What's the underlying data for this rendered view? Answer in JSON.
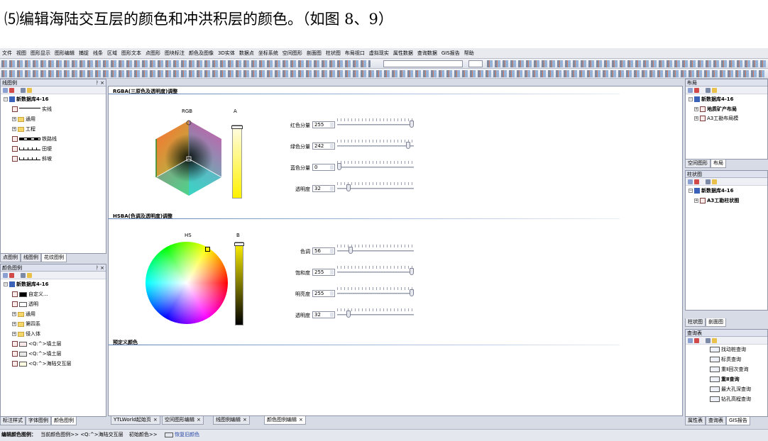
{
  "caption": "⑸编辑海陆交互层的颜色和冲洪积层的颜色。（如图 8、9）",
  "menu": [
    "文件",
    "视图",
    "图形显示",
    "图形编辑",
    "捕捉",
    "线条",
    "区域",
    "图形文本",
    "点图形",
    "图块标注",
    "颜色及图像",
    "3D实体",
    "数据点",
    "坐标系统",
    "空间图形",
    "剖面图",
    "柱状图",
    "布局视口",
    "虚拟现实",
    "属性数据",
    "查询数据",
    "GIS报告",
    "帮助"
  ],
  "left_top_panel": {
    "title": "线图例",
    "tree": {
      "root": "新数据库4-16",
      "items": [
        {
          "label": "实线",
          "type": "line-solid"
        },
        {
          "label": "通用",
          "type": "folder"
        },
        {
          "label": "工程",
          "type": "folder"
        },
        {
          "label": "铁路线",
          "type": "line-rail"
        },
        {
          "label": "田埂",
          "type": "line-ridge"
        },
        {
          "label": "斜坡",
          "type": "line-slope"
        }
      ]
    },
    "tabs": [
      "点图例",
      "线图例",
      "花纹图例"
    ]
  },
  "left_bottom_panel": {
    "title": "颜色图例",
    "tree": {
      "root": "新数据库4-16",
      "items": [
        {
          "label": "自定义...",
          "swatch": "#000000"
        },
        {
          "label": "透明",
          "swatch": "#ffffff"
        },
        {
          "label": "通用",
          "type": "folder"
        },
        {
          "label": "第四系",
          "type": "folder"
        },
        {
          "label": "侵入体",
          "type": "folder"
        },
        {
          "label": "<Q:^>填土层",
          "swatch": "#f8e8ea"
        },
        {
          "label": "<Q:^>填土层",
          "swatch": "#e8e8e8"
        },
        {
          "label": "<Q:^>海陆交互层",
          "swatch": "#fffbe0"
        }
      ]
    },
    "tabs": [
      "标注样式",
      "字体图例",
      "颜色图例"
    ]
  },
  "editor": {
    "rgba_title": "RGBA(三原色及透明度)调整",
    "hsba_title": "HSBA(色调及透明度)调整",
    "preset_title": "预定义颜色",
    "rgb_label": "RGB",
    "a_label": "A",
    "hs_label": "HS",
    "b_label": "B",
    "rgba_sliders": [
      {
        "label": "红色分量",
        "value": "255",
        "max": 255
      },
      {
        "label": "绿色分量",
        "value": "242",
        "max": 255
      },
      {
        "label": "蓝色分量",
        "value": "0",
        "max": 255
      },
      {
        "label": "透明度",
        "value": "32",
        "max": 255
      }
    ],
    "hsba_sliders": [
      {
        "label": "色调",
        "value": "56",
        "max": 360
      },
      {
        "label": "饱和度",
        "value": "255",
        "max": 255
      },
      {
        "label": "明亮度",
        "value": "255",
        "max": 255
      },
      {
        "label": "透明度",
        "value": "32",
        "max": 255
      }
    ],
    "current_color": "#fff200"
  },
  "doc_tabs": [
    "YTLWorld起始页",
    "空间图形编辑",
    "线图例编辑",
    "颜色图例编辑"
  ],
  "right_panels": {
    "layout": {
      "title": "布局",
      "root": "新数据库4-16",
      "items": [
        "地质矿产布局",
        "A3工勘布局模"
      ],
      "tabs": [
        "空间图形",
        "布局"
      ]
    },
    "column": {
      "title": "柱状图",
      "root": "新数据库4-16",
      "items": [
        "A3工勘柱状图"
      ],
      "tabs": [
        "柱状图",
        "剖面图"
      ]
    },
    "query": {
      "title": "查询表",
      "items": [
        "找动桩查询",
        "标贯查询",
        "重Ⅱ回次查询",
        "重Ⅱ查询",
        "最大孔深查询",
        "钻孔高程查询"
      ],
      "tabs": [
        "属性表",
        "查询表",
        "GIS报告"
      ]
    }
  },
  "status": {
    "label": "编辑颜色图例：",
    "current": "当前颜色图例>> <Q:^>海陆交互层",
    "initial": "初始颜色>>",
    "restore": "恢复旧颜色"
  }
}
